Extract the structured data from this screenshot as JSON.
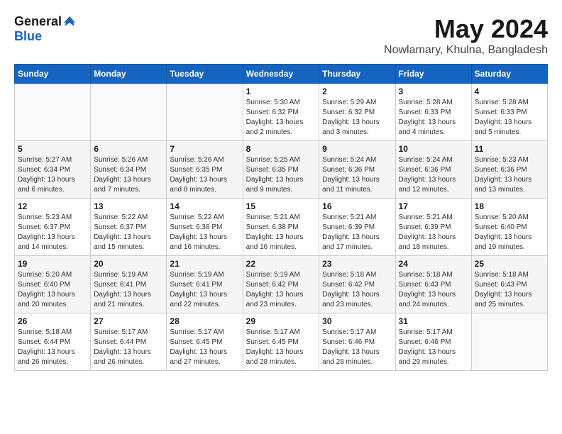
{
  "logo": {
    "general": "General",
    "blue": "Blue"
  },
  "title": "May 2024",
  "subtitle": "Nowlamary, Khulna, Bangladesh",
  "header_days": [
    "Sunday",
    "Monday",
    "Tuesday",
    "Wednesday",
    "Thursday",
    "Friday",
    "Saturday"
  ],
  "weeks": [
    [
      {
        "day": "",
        "info": ""
      },
      {
        "day": "",
        "info": ""
      },
      {
        "day": "",
        "info": ""
      },
      {
        "day": "1",
        "info": "Sunrise: 5:30 AM\nSunset: 6:32 PM\nDaylight: 13 hours\nand 2 minutes."
      },
      {
        "day": "2",
        "info": "Sunrise: 5:29 AM\nSunset: 6:32 PM\nDaylight: 13 hours\nand 3 minutes."
      },
      {
        "day": "3",
        "info": "Sunrise: 5:28 AM\nSunset: 6:33 PM\nDaylight: 13 hours\nand 4 minutes."
      },
      {
        "day": "4",
        "info": "Sunrise: 5:28 AM\nSunset: 6:33 PM\nDaylight: 13 hours\nand 5 minutes."
      }
    ],
    [
      {
        "day": "5",
        "info": "Sunrise: 5:27 AM\nSunset: 6:34 PM\nDaylight: 13 hours\nand 6 minutes."
      },
      {
        "day": "6",
        "info": "Sunrise: 5:26 AM\nSunset: 6:34 PM\nDaylight: 13 hours\nand 7 minutes."
      },
      {
        "day": "7",
        "info": "Sunrise: 5:26 AM\nSunset: 6:35 PM\nDaylight: 13 hours\nand 8 minutes."
      },
      {
        "day": "8",
        "info": "Sunrise: 5:25 AM\nSunset: 6:35 PM\nDaylight: 13 hours\nand 9 minutes."
      },
      {
        "day": "9",
        "info": "Sunrise: 5:24 AM\nSunset: 6:36 PM\nDaylight: 13 hours\nand 11 minutes."
      },
      {
        "day": "10",
        "info": "Sunrise: 5:24 AM\nSunset: 6:36 PM\nDaylight: 13 hours\nand 12 minutes."
      },
      {
        "day": "11",
        "info": "Sunrise: 5:23 AM\nSunset: 6:36 PM\nDaylight: 13 hours\nand 13 minutes."
      }
    ],
    [
      {
        "day": "12",
        "info": "Sunrise: 5:23 AM\nSunset: 6:37 PM\nDaylight: 13 hours\nand 14 minutes."
      },
      {
        "day": "13",
        "info": "Sunrise: 5:22 AM\nSunset: 6:37 PM\nDaylight: 13 hours\nand 15 minutes."
      },
      {
        "day": "14",
        "info": "Sunrise: 5:22 AM\nSunset: 6:38 PM\nDaylight: 13 hours\nand 16 minutes."
      },
      {
        "day": "15",
        "info": "Sunrise: 5:21 AM\nSunset: 6:38 PM\nDaylight: 13 hours\nand 16 minutes."
      },
      {
        "day": "16",
        "info": "Sunrise: 5:21 AM\nSunset: 6:39 PM\nDaylight: 13 hours\nand 17 minutes."
      },
      {
        "day": "17",
        "info": "Sunrise: 5:21 AM\nSunset: 6:39 PM\nDaylight: 13 hours\nand 18 minutes."
      },
      {
        "day": "18",
        "info": "Sunrise: 5:20 AM\nSunset: 6:40 PM\nDaylight: 13 hours\nand 19 minutes."
      }
    ],
    [
      {
        "day": "19",
        "info": "Sunrise: 5:20 AM\nSunset: 6:40 PM\nDaylight: 13 hours\nand 20 minutes."
      },
      {
        "day": "20",
        "info": "Sunrise: 5:19 AM\nSunset: 6:41 PM\nDaylight: 13 hours\nand 21 minutes."
      },
      {
        "day": "21",
        "info": "Sunrise: 5:19 AM\nSunset: 6:41 PM\nDaylight: 13 hours\nand 22 minutes."
      },
      {
        "day": "22",
        "info": "Sunrise: 5:19 AM\nSunset: 6:42 PM\nDaylight: 13 hours\nand 23 minutes."
      },
      {
        "day": "23",
        "info": "Sunrise: 5:18 AM\nSunset: 6:42 PM\nDaylight: 13 hours\nand 23 minutes."
      },
      {
        "day": "24",
        "info": "Sunrise: 5:18 AM\nSunset: 6:43 PM\nDaylight: 13 hours\nand 24 minutes."
      },
      {
        "day": "25",
        "info": "Sunrise: 5:18 AM\nSunset: 6:43 PM\nDaylight: 13 hours\nand 25 minutes."
      }
    ],
    [
      {
        "day": "26",
        "info": "Sunrise: 5:18 AM\nSunset: 6:44 PM\nDaylight: 13 hours\nand 26 minutes."
      },
      {
        "day": "27",
        "info": "Sunrise: 5:17 AM\nSunset: 6:44 PM\nDaylight: 13 hours\nand 26 minutes."
      },
      {
        "day": "28",
        "info": "Sunrise: 5:17 AM\nSunset: 6:45 PM\nDaylight: 13 hours\nand 27 minutes."
      },
      {
        "day": "29",
        "info": "Sunrise: 5:17 AM\nSunset: 6:45 PM\nDaylight: 13 hours\nand 28 minutes."
      },
      {
        "day": "30",
        "info": "Sunrise: 5:17 AM\nSunset: 6:46 PM\nDaylight: 13 hours\nand 28 minutes."
      },
      {
        "day": "31",
        "info": "Sunrise: 5:17 AM\nSunset: 6:46 PM\nDaylight: 13 hours\nand 29 minutes."
      },
      {
        "day": "",
        "info": ""
      }
    ]
  ]
}
